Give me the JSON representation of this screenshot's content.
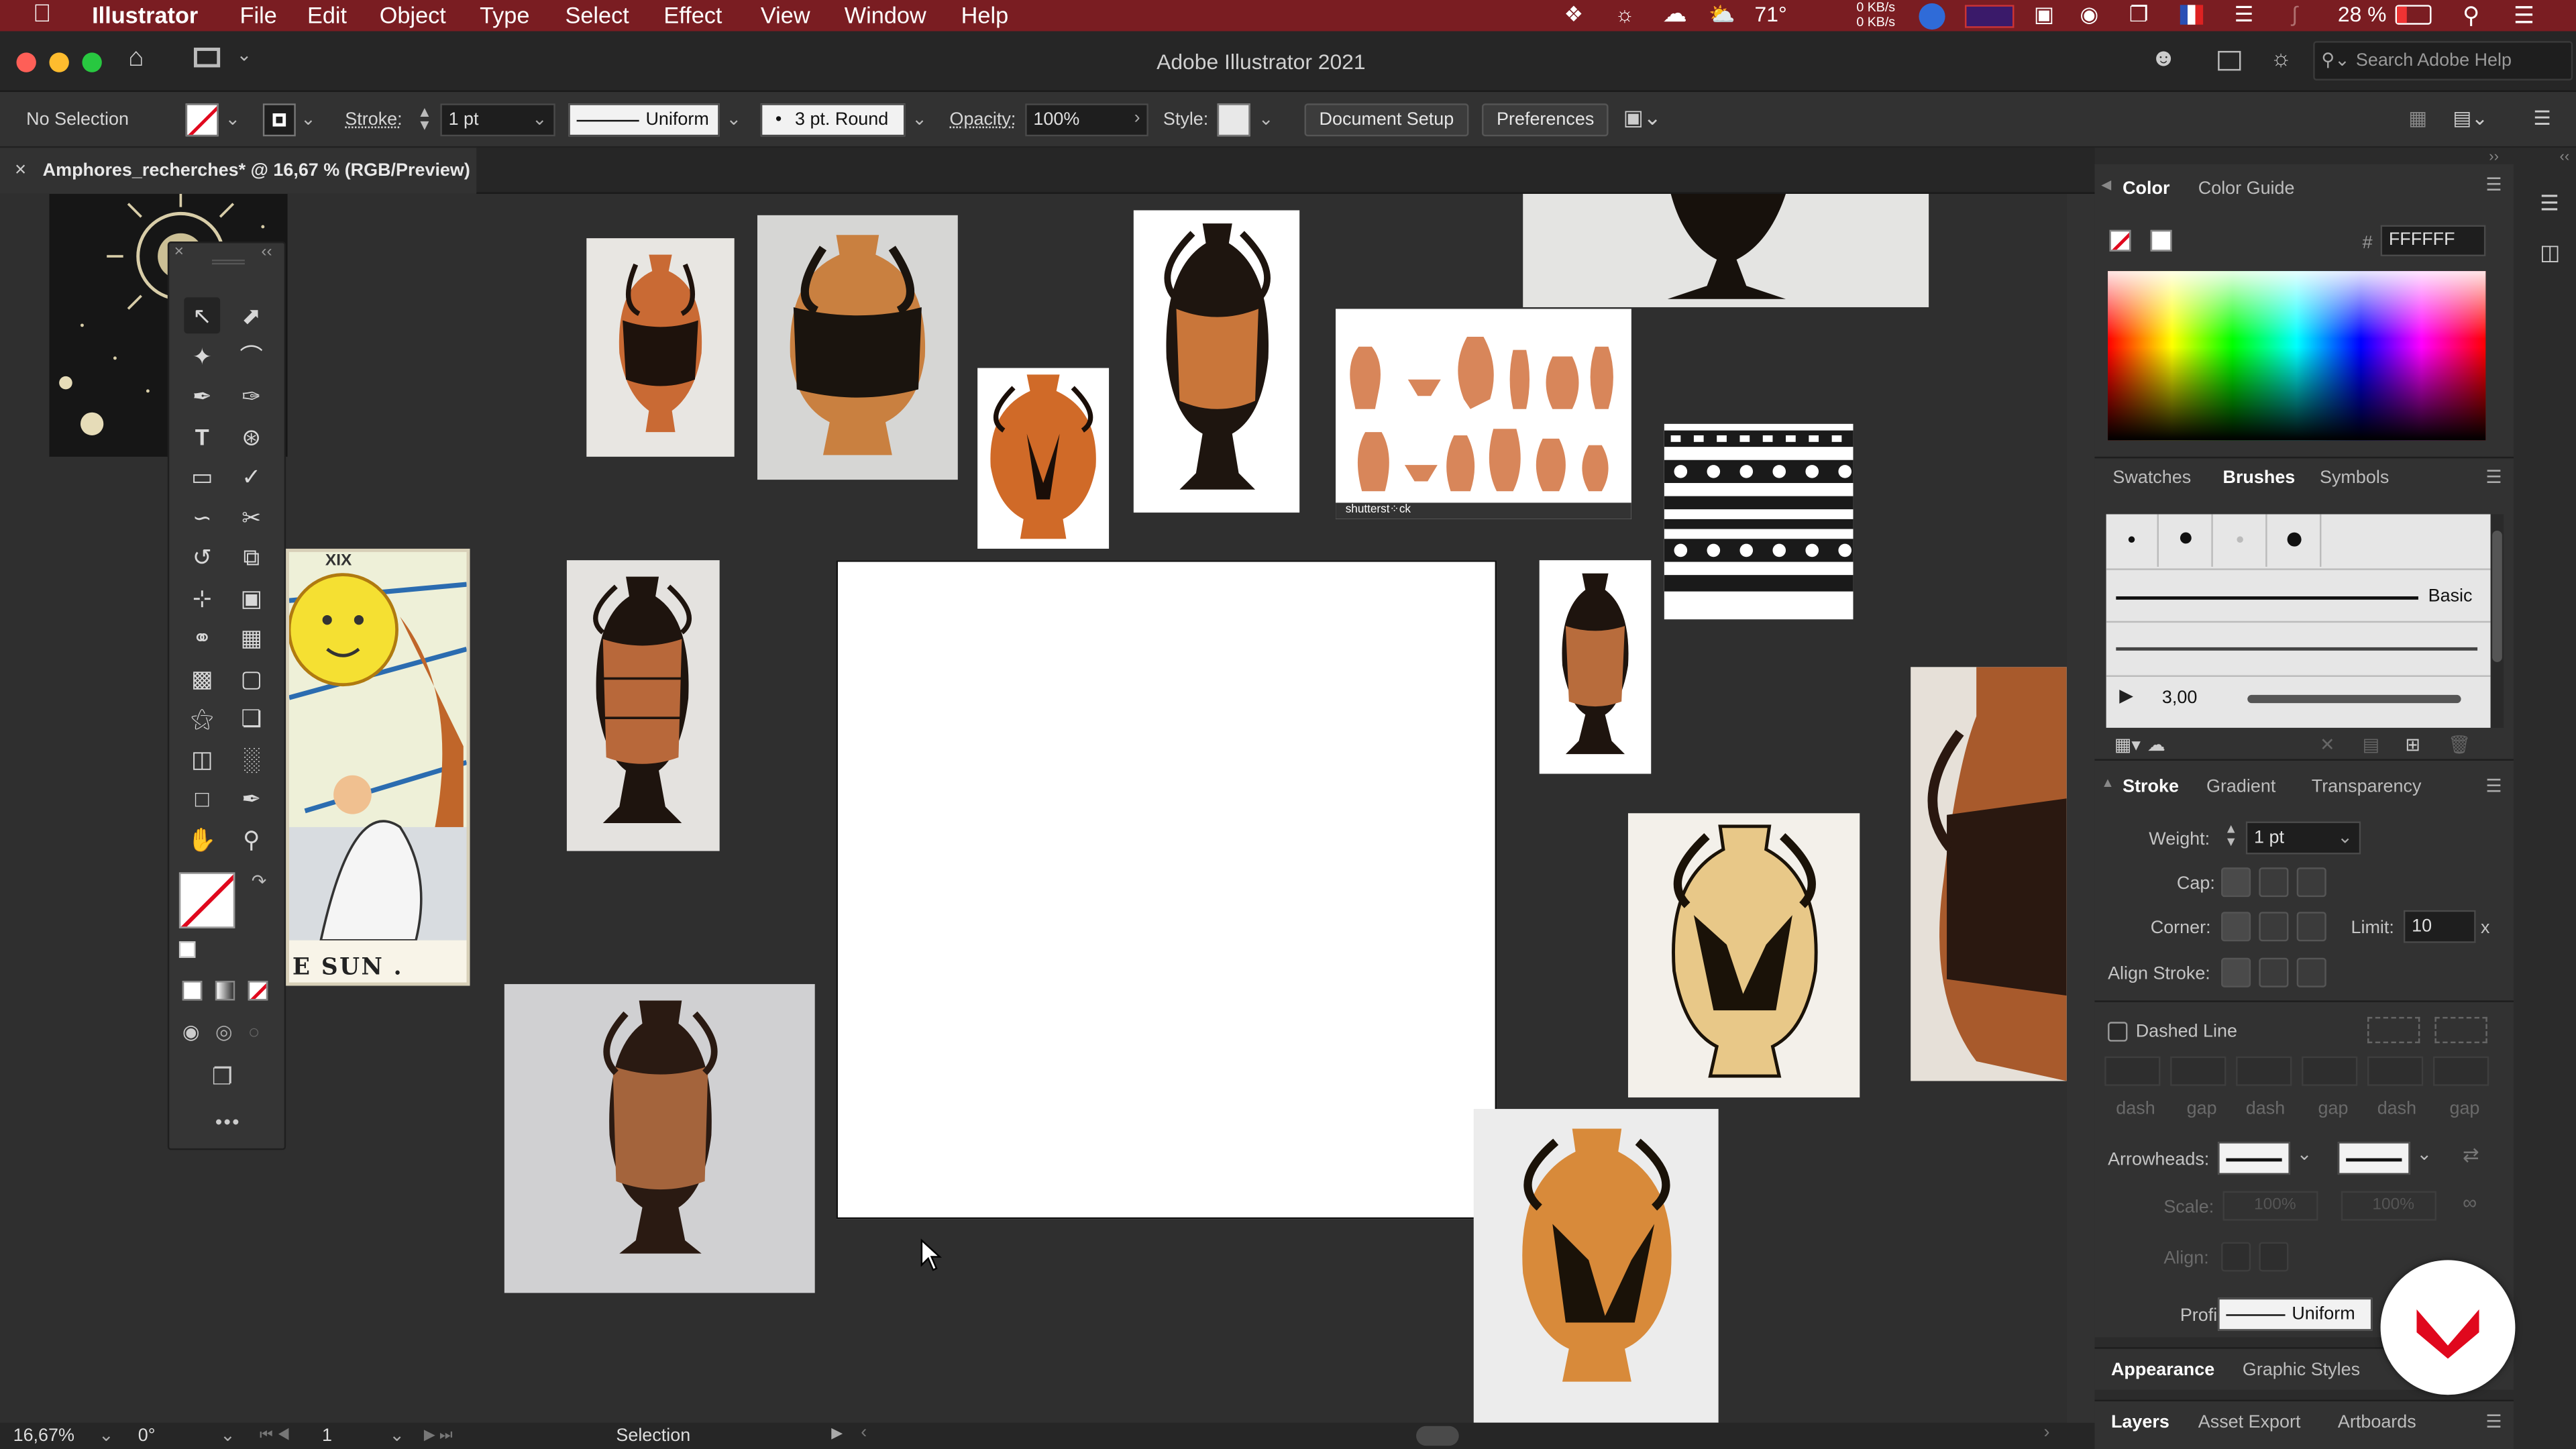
{
  "menubar": {
    "app_name": "Illustrator",
    "items": [
      "File",
      "Edit",
      "Object",
      "Type",
      "Select",
      "Effect",
      "View",
      "Window",
      "Help"
    ],
    "status": {
      "temperature": "71°",
      "network_up": "0 KB/s",
      "network_down": "0 KB/s",
      "battery": "28 %"
    }
  },
  "window": {
    "title": "Adobe Illustrator 2021",
    "search_placeholder": "Search Adobe Help"
  },
  "control_bar": {
    "selection": "No Selection",
    "stroke_label": "Stroke:",
    "stroke_value": "1 pt",
    "profile": "Uniform",
    "brush": "3 pt. Round",
    "opacity_label": "Opacity:",
    "opacity_value": "100%",
    "style_label": "Style:",
    "document_setup": "Document Setup",
    "preferences": "Preferences"
  },
  "document_tab": {
    "title": "Amphores_recherches* @ 16,67 % (RGB/Preview)"
  },
  "canvas": {
    "tarot_title": "XIX",
    "tarot_caption": "E SUN .",
    "shutterstock_caption": "shutterst⁘ck"
  },
  "status_bar": {
    "zoom": "16,67%",
    "rotation": "0°",
    "artboard": "1",
    "tool": "Selection"
  },
  "color_panel": {
    "tabs": [
      "Color",
      "Color Guide"
    ],
    "hex_label": "#",
    "hex": "FFFFFF"
  },
  "brushes_panel": {
    "tabs": [
      "Swatches",
      "Brushes",
      "Symbols"
    ],
    "basic_label": "Basic",
    "size": "3,00"
  },
  "stroke_panel": {
    "tabs": [
      "Stroke",
      "Gradient",
      "Transparency"
    ],
    "weight_label": "Weight:",
    "weight_value": "1 pt",
    "cap_label": "Cap:",
    "corner_label": "Corner:",
    "limit_label": "Limit:",
    "limit_value": "10",
    "limit_unit": "x",
    "align_label": "Align Stroke:",
    "dashed_label": "Dashed Line",
    "dash_labels": [
      "dash",
      "gap",
      "dash",
      "gap",
      "dash",
      "gap"
    ],
    "arrowheads_label": "Arrowheads:",
    "scale_label": "Scale:",
    "scale_value_1": "100%",
    "scale_value_2": "100%",
    "align_arrow_label": "Align:",
    "profile_label": "Profile:",
    "profile_value": "Uniform"
  },
  "bottom_tabs": {
    "row1": [
      "Appearance",
      "Graphic Styles"
    ],
    "row2": [
      "Layers",
      "Asset Export",
      "Artboards"
    ]
  },
  "colors": {
    "menubar": "#7a1d22",
    "accent": "#e0081d",
    "terracotta": "#c96a34"
  }
}
